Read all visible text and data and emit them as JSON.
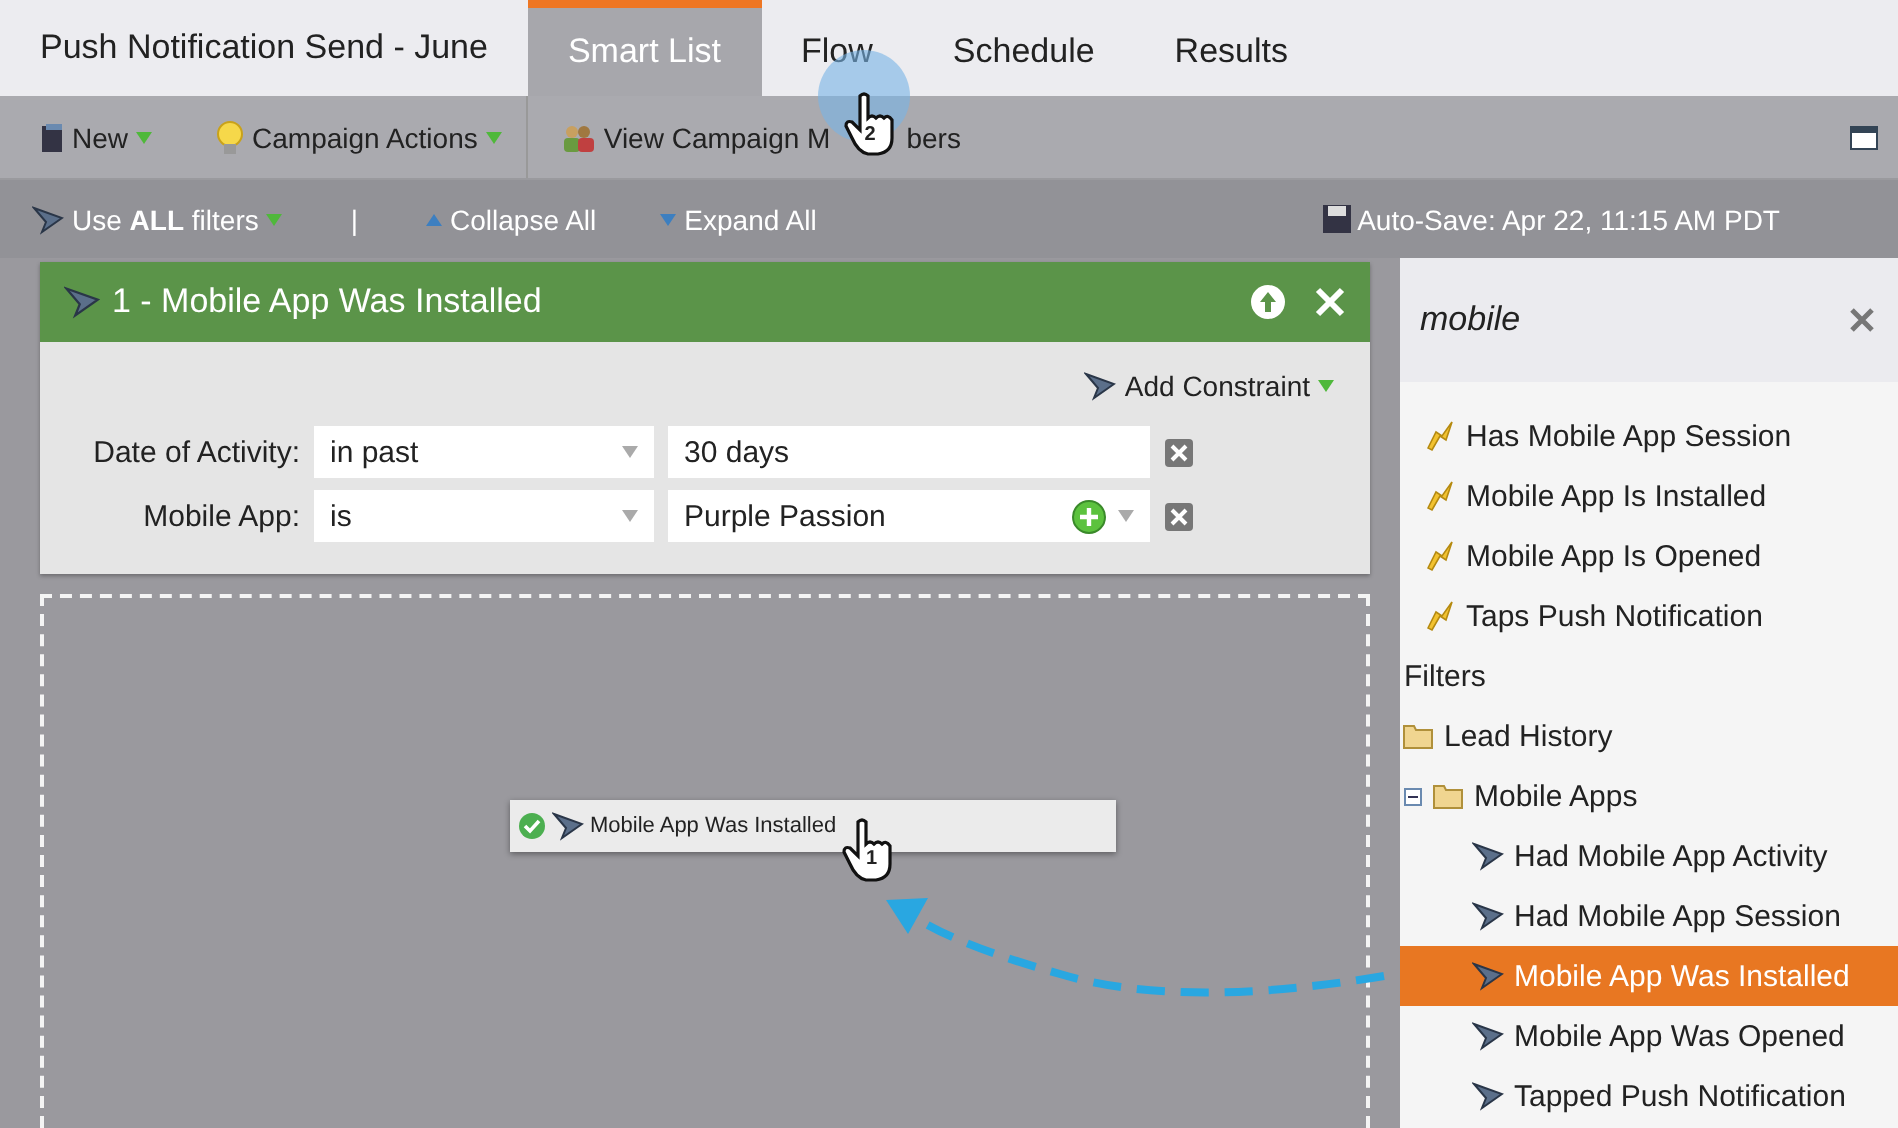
{
  "window": {
    "title": "Push Notification Send - June"
  },
  "tabs": [
    {
      "label": "Smart List",
      "selected": true
    },
    {
      "label": "Flow",
      "selected": false
    },
    {
      "label": "Schedule",
      "selected": false
    },
    {
      "label": "Results",
      "selected": false
    }
  ],
  "flow_cursor_step": "2",
  "toolbar": [
    {
      "kind": "new",
      "label": "New",
      "dropdown": true
    },
    {
      "kind": "actions",
      "label": "Campaign Actions",
      "dropdown": true
    },
    {
      "kind": "members",
      "label": "View Campaign M",
      "label_end": "bers",
      "dropdown": false
    }
  ],
  "filter_bar": {
    "logic": "Use **ALL** filters",
    "separator": "|",
    "collapse": "Collapse All",
    "expand": "Expand All",
    "autosave": "Auto-Save: Apr 22, 11:15 AM PDT"
  },
  "filters": [
    {
      "title": "1 - Mobile App Was Installed",
      "add_constraint": "Add Constraint",
      "rows": [
        {
          "label": "Date of Activity:",
          "operator": "in past",
          "value": "30 days",
          "addable": false
        },
        {
          "label": "Mobile App:",
          "operator": "is",
          "value": "Purple Passion",
          "addable": true
        }
      ]
    }
  ],
  "drag_item": {
    "label": "Mobile App Was Installed",
    "step": "1"
  },
  "palette": {
    "search": "mobile",
    "items": [
      {
        "kind": "trigger",
        "label": "Has Mobile App Session"
      },
      {
        "kind": "trigger",
        "label": "Mobile App Is Installed"
      },
      {
        "kind": "trigger",
        "label": "Mobile App Is Opened"
      },
      {
        "kind": "trigger",
        "label": "Taps Push Notification"
      },
      {
        "kind": "heading",
        "label": "Filters"
      },
      {
        "kind": "folder",
        "label": "Lead History",
        "expanded": false
      },
      {
        "kind": "folder",
        "label": "Mobile Apps",
        "expanded": true,
        "children": [
          {
            "label": "Had Mobile App Activity",
            "selected": false
          },
          {
            "label": "Had Mobile App Session",
            "selected": false
          },
          {
            "label": "Mobile App Was Installed",
            "selected": true
          },
          {
            "label": "Mobile App Was Opened",
            "selected": false
          },
          {
            "label": "Tapped Push Notification",
            "selected": false
          }
        ]
      }
    ]
  }
}
